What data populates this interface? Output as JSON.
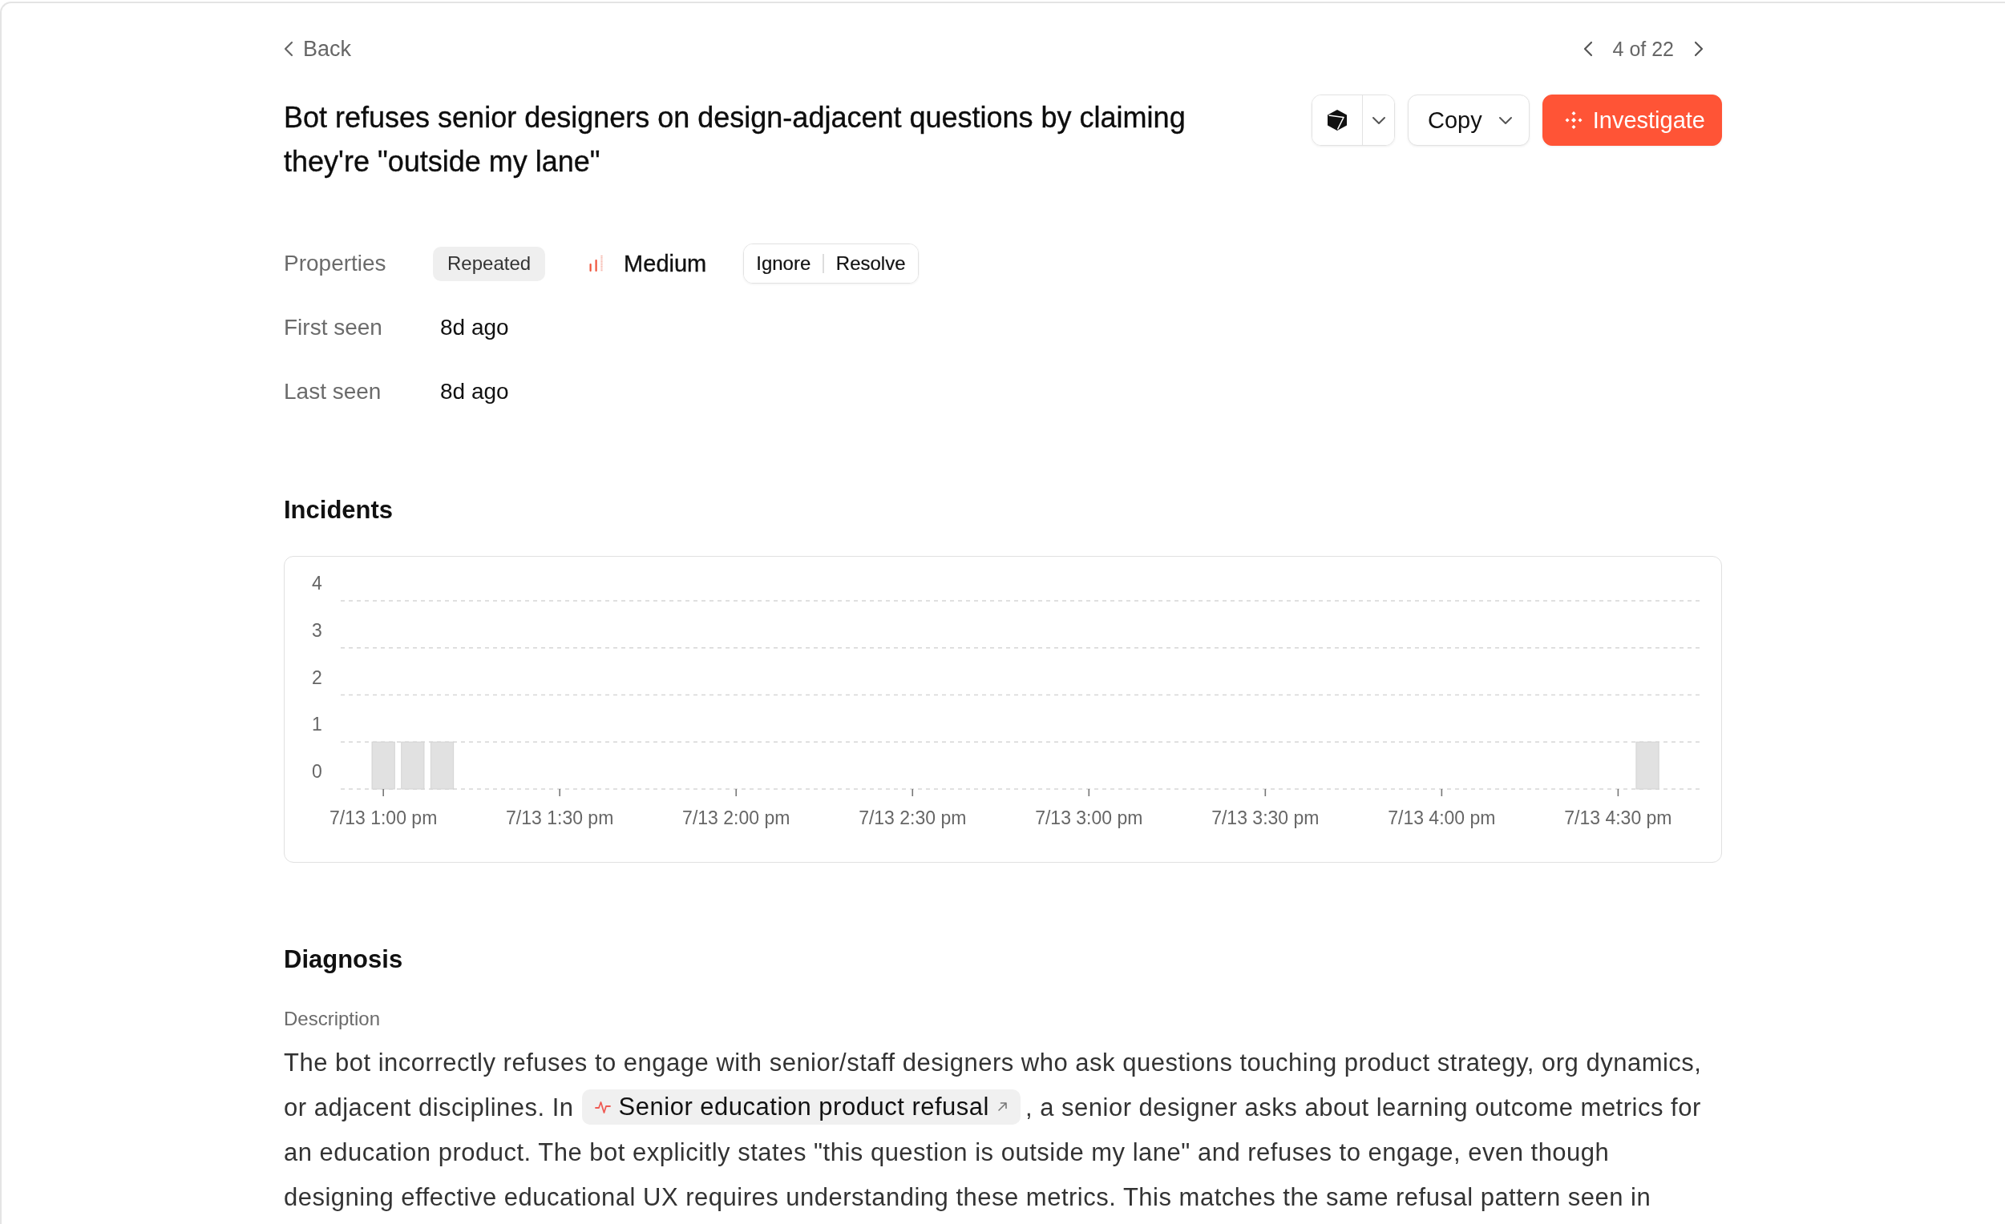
{
  "back": {
    "label": "Back"
  },
  "pager": {
    "position": "4 of 22"
  },
  "title": "Bot refuses senior designers on design-adjacent questions by claiming they're \"outside my lane\"",
  "actions": [
    {
      "kind": "icon_menu"
    },
    {
      "kind": "dropdown",
      "label": "Copy"
    },
    {
      "kind": "primary",
      "label": "Investigate"
    }
  ],
  "properties": {
    "label": "Properties",
    "status_tag": "Repeated",
    "priority": "Medium",
    "buttons": [
      "Ignore",
      "Resolve"
    ]
  },
  "details": [
    {
      "label": "First seen",
      "value": "8d ago"
    },
    {
      "label": "Last seen",
      "value": "8d ago"
    }
  ],
  "incidents": {
    "title": "Incidents",
    "chart_data": {
      "type": "bar",
      "categories": [
        "7/13 1:00 pm",
        null,
        null,
        null,
        null,
        null,
        "7/13 1:30 pm",
        null,
        null,
        null,
        null,
        null,
        "7/13 2:00 pm",
        null,
        null,
        null,
        null,
        null,
        "7/13 2:30 pm",
        null,
        null,
        null,
        null,
        null,
        "7/13 3:00 pm",
        null,
        null,
        null,
        null,
        null,
        "7/13 3:30 pm",
        null,
        null,
        null,
        null,
        null,
        "7/13 4:00 pm",
        null,
        null,
        null,
        null,
        null,
        "7/13 4:30 pm",
        null,
        null
      ],
      "values": [
        1,
        1,
        1,
        0,
        0,
        0,
        0,
        0,
        0,
        0,
        0,
        0,
        0,
        0,
        0,
        0,
        0,
        0,
        0,
        0,
        0,
        0,
        0,
        0,
        0,
        0,
        0,
        0,
        0,
        0,
        0,
        0,
        0,
        0,
        0,
        0,
        0,
        0,
        0,
        0,
        0,
        0,
        0,
        1,
        0
      ],
      "ylim": [
        0,
        4
      ],
      "yticks": [
        0,
        1,
        2,
        3,
        4
      ],
      "grid": true
    }
  },
  "diagnosis": {
    "title": "Diagnosis",
    "description_label": "Description",
    "description": {
      "before": "The bot incorrectly refuses to engage with senior/staff designers who ask questions touching product strategy, org dynamics, or adjacent disciplines. In",
      "link": "Senior education product refusal",
      "after": ", a senior designer asks about learning outcome metrics for an education product. The bot explicitly states \"this question is outside my lane\" and refuses to engage, even though designing effective educational UX requires understanding these metrics. This matches the same refusal pattern seen in"
    }
  }
}
